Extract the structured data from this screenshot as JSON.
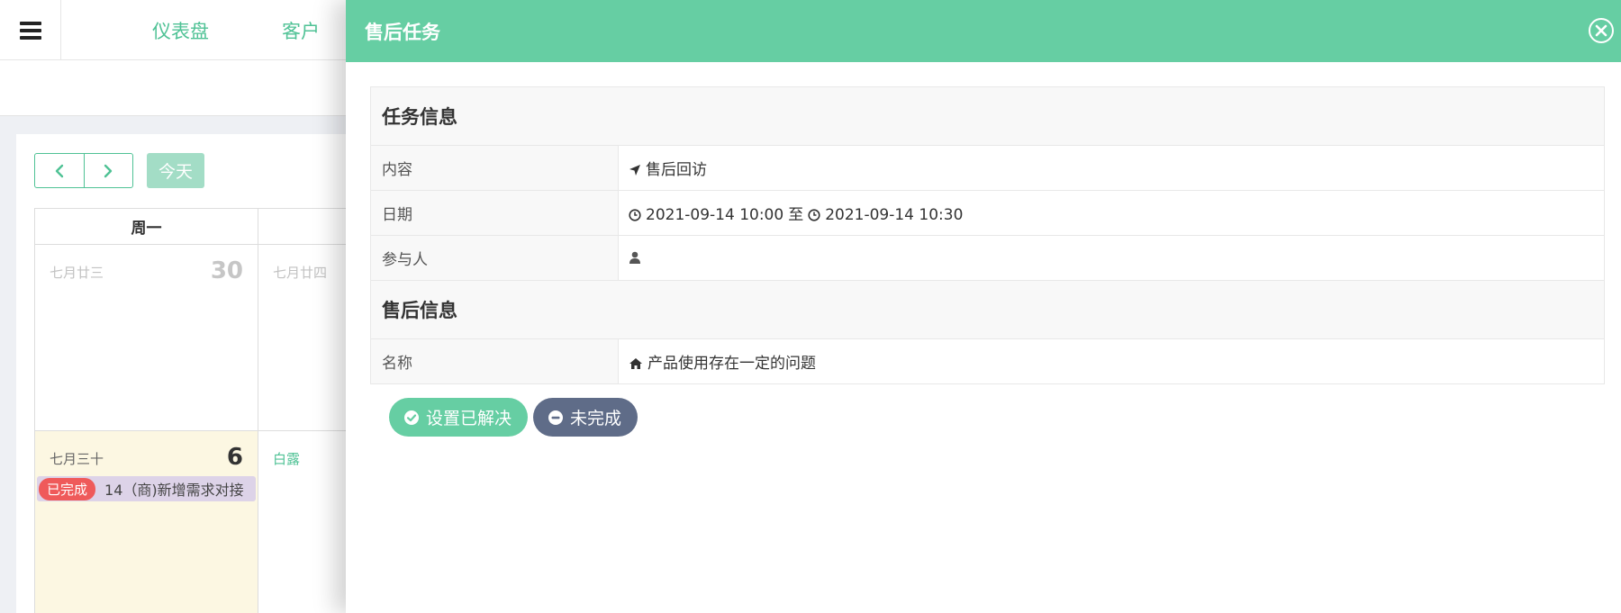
{
  "topbar": {
    "nav": [
      "仪表盘",
      "客户"
    ]
  },
  "calendar": {
    "today_label": "今天",
    "weekday_header": "周一",
    "week1": [
      {
        "lunar": "七月廿三",
        "day": "30"
      },
      {
        "lunar": "七月廿四",
        "day": ""
      }
    ],
    "week2": [
      {
        "lunar": "七月三十",
        "day": "6"
      },
      {
        "lunar": "白露",
        "day": ""
      }
    ],
    "event": {
      "badge": "已完成",
      "text": "14（商)新增需求对接"
    }
  },
  "drawer": {
    "title": "售后任务",
    "task_section": "任务信息",
    "rows": {
      "content_label": "内容",
      "content_value": "售后回访",
      "date_label": "日期",
      "date_start": "2021-09-14 10:00",
      "date_sep": "至",
      "date_end": "2021-09-14 10:30",
      "participants_label": "参与人",
      "participants_value": ""
    },
    "aftersale_section": "售后信息",
    "name_label": "名称",
    "name_value": "产品使用存在一定的问题",
    "buttons": {
      "resolve": "设置已解决",
      "pending": "未完成"
    }
  },
  "colors": {
    "primary": "#66cea3",
    "nav_text": "#4fc295",
    "badge_red": "#ef5a5a",
    "pending_btn": "#5f6c88",
    "today_bg": "#fcf7e2",
    "event_bg": "#ddd3e8"
  },
  "icons": [
    "menu-icon",
    "chevron-left-icon",
    "chevron-right-icon",
    "close-icon",
    "location-arrow-icon",
    "clock-icon",
    "user-icon",
    "home-icon",
    "check-circle-icon",
    "minus-circle-icon"
  ]
}
